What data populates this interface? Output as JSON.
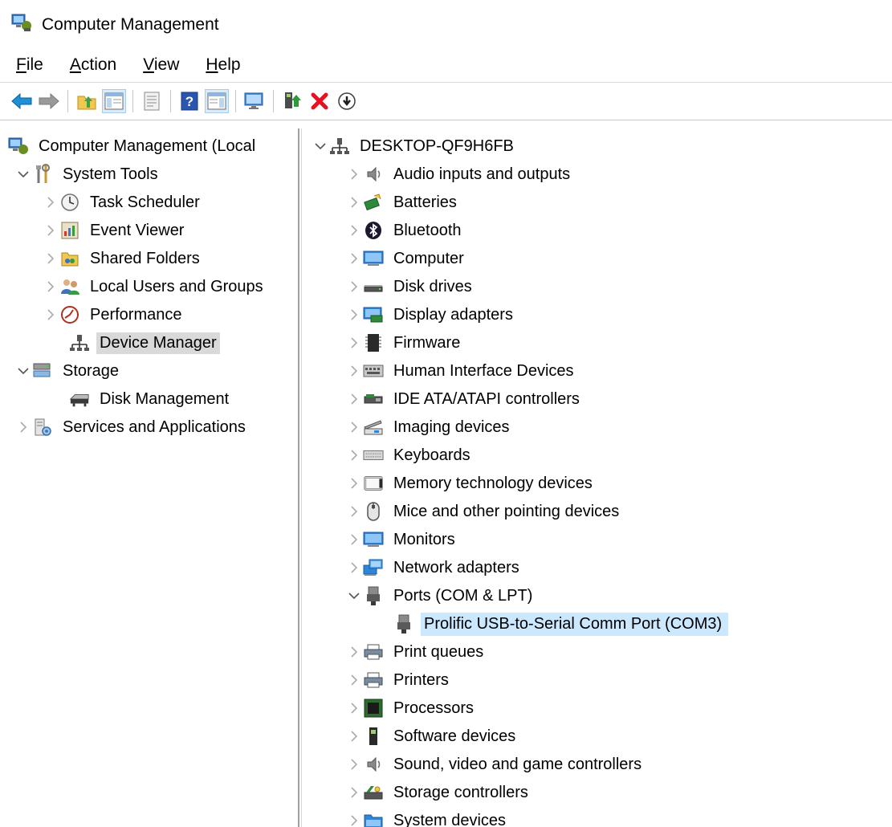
{
  "window": {
    "title": "Computer Management"
  },
  "menu": [
    {
      "accel": "F",
      "rest": "ile"
    },
    {
      "accel": "A",
      "rest": "ction"
    },
    {
      "accel": "V",
      "rest": "iew"
    },
    {
      "accel": "H",
      "rest": "elp"
    }
  ],
  "toolbar": {
    "icons": [
      "back-arrow-icon",
      "forward-arrow-icon",
      "up-folder-icon",
      "show-hide-console-tree-icon",
      "properties-icon",
      "help-icon",
      "show-hide-action-pane-icon",
      "monitor-icon",
      "update-driver-icon",
      "uninstall-icon",
      "download-icon"
    ]
  },
  "left_tree": {
    "root": "Computer Management (Local",
    "system_tools": "System Tools",
    "task_scheduler": "Task Scheduler",
    "event_viewer": "Event Viewer",
    "shared_folders": "Shared Folders",
    "local_users": "Local Users and Groups",
    "performance": "Performance",
    "device_manager": "Device Manager",
    "storage": "Storage",
    "disk_management": "Disk Management",
    "services": "Services and Applications"
  },
  "device_tree": {
    "root": "DESKTOP-QF9H6FB",
    "categories": [
      "Audio inputs and outputs",
      "Batteries",
      "Bluetooth",
      "Computer",
      "Disk drives",
      "Display adapters",
      "Firmware",
      "Human Interface Devices",
      "IDE ATA/ATAPI controllers",
      "Imaging devices",
      "Keyboards",
      "Memory technology devices",
      "Mice and other pointing devices",
      "Monitors",
      "Network adapters",
      "Ports (COM & LPT)",
      "Print queues",
      "Printers",
      "Processors",
      "Software devices",
      "Sound, video and game controllers",
      "Storage controllers",
      "System devices"
    ],
    "port_device": "Prolific USB-to-Serial Comm Port (COM3)"
  },
  "colors": {
    "selection_blue": "#cce8ff",
    "selection_gray": "#d9d9d9",
    "uninstall_red": "#e81123"
  }
}
